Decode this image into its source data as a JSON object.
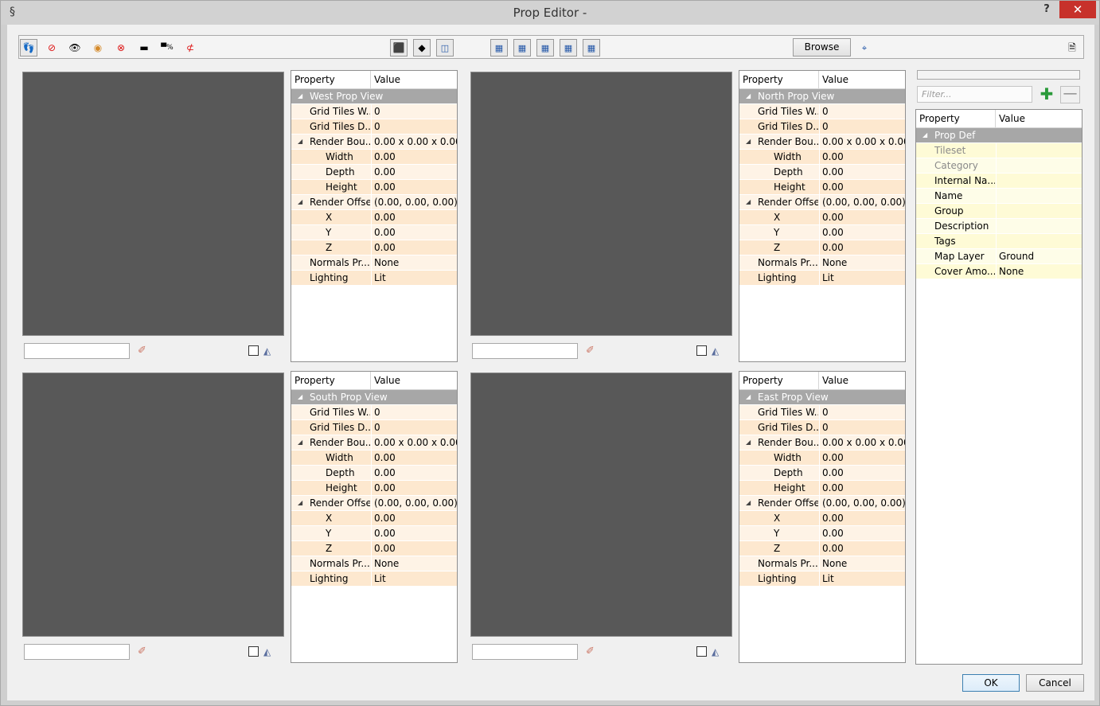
{
  "window": {
    "title": "Prop Editor -",
    "help_label": "?",
    "close_label": "✕"
  },
  "toolbar": {
    "browse_label": "Browse",
    "icons": [
      "footprint-icon",
      "footprint-disabled-icon",
      "eye-icon",
      "eye-orange-icon",
      "eye-disabled-icon",
      "line-icon",
      "percent-overlay-icon",
      "line-disabled-icon",
      "cube-top-icon",
      "plane-icon",
      "rotate-view-icon",
      "layout-1-icon",
      "layout-2-icon",
      "layout-3-icon",
      "layout-4-icon",
      "layout-5-icon",
      "target-icon",
      "save-icon"
    ]
  },
  "grid_headers": {
    "property": "Property",
    "value": "Value"
  },
  "views": [
    {
      "section": "West Prop View",
      "rows": [
        {
          "label": "Grid Tiles W...",
          "value": "0",
          "level": 1
        },
        {
          "label": "Grid Tiles D...",
          "value": "0",
          "level": 1
        },
        {
          "label": "Render Bou...",
          "value": "0.00 x 0.00 x 0.00",
          "level": 1,
          "expanded": true
        },
        {
          "label": "Width",
          "value": "0.00",
          "level": 2
        },
        {
          "label": "Depth",
          "value": "0.00",
          "level": 2
        },
        {
          "label": "Height",
          "value": "0.00",
          "level": 2
        },
        {
          "label": "Render Offset",
          "value": "(0.00, 0.00, 0.00)",
          "level": 1,
          "expanded": true
        },
        {
          "label": "X",
          "value": "0.00",
          "level": 2
        },
        {
          "label": "Y",
          "value": "0.00",
          "level": 2
        },
        {
          "label": "Z",
          "value": "0.00",
          "level": 2
        },
        {
          "label": "Normals Pr...",
          "value": "None",
          "level": 1
        },
        {
          "label": "Lighting",
          "value": "Lit",
          "level": 1
        }
      ]
    },
    {
      "section": "North Prop View",
      "rows": [
        {
          "label": "Grid Tiles W...",
          "value": "0",
          "level": 1
        },
        {
          "label": "Grid Tiles D...",
          "value": "0",
          "level": 1
        },
        {
          "label": "Render Bou...",
          "value": "0.00 x 0.00 x 0.00",
          "level": 1,
          "expanded": true
        },
        {
          "label": "Width",
          "value": "0.00",
          "level": 2
        },
        {
          "label": "Depth",
          "value": "0.00",
          "level": 2
        },
        {
          "label": "Height",
          "value": "0.00",
          "level": 2
        },
        {
          "label": "Render Offset",
          "value": "(0.00, 0.00, 0.00)",
          "level": 1,
          "expanded": true
        },
        {
          "label": "X",
          "value": "0.00",
          "level": 2
        },
        {
          "label": "Y",
          "value": "0.00",
          "level": 2
        },
        {
          "label": "Z",
          "value": "0.00",
          "level": 2
        },
        {
          "label": "Normals Pr...",
          "value": "None",
          "level": 1
        },
        {
          "label": "Lighting",
          "value": "Lit",
          "level": 1
        }
      ]
    },
    {
      "section": "South Prop View",
      "rows": [
        {
          "label": "Grid Tiles W...",
          "value": "0",
          "level": 1
        },
        {
          "label": "Grid Tiles D...",
          "value": "0",
          "level": 1
        },
        {
          "label": "Render Bou...",
          "value": "0.00 x 0.00 x 0.00",
          "level": 1,
          "expanded": true
        },
        {
          "label": "Width",
          "value": "0.00",
          "level": 2
        },
        {
          "label": "Depth",
          "value": "0.00",
          "level": 2
        },
        {
          "label": "Height",
          "value": "0.00",
          "level": 2
        },
        {
          "label": "Render Offset",
          "value": "(0.00, 0.00, 0.00)",
          "level": 1,
          "expanded": true
        },
        {
          "label": "X",
          "value": "0.00",
          "level": 2
        },
        {
          "label": "Y",
          "value": "0.00",
          "level": 2
        },
        {
          "label": "Z",
          "value": "0.00",
          "level": 2
        },
        {
          "label": "Normals Pr...",
          "value": "None",
          "level": 1
        },
        {
          "label": "Lighting",
          "value": "Lit",
          "level": 1
        }
      ]
    },
    {
      "section": "East Prop View",
      "rows": [
        {
          "label": "Grid Tiles W...",
          "value": "0",
          "level": 1
        },
        {
          "label": "Grid Tiles D...",
          "value": "0",
          "level": 1
        },
        {
          "label": "Render Bou...",
          "value": "0.00 x 0.00 x 0.00",
          "level": 1,
          "expanded": true
        },
        {
          "label": "Width",
          "value": "0.00",
          "level": 2
        },
        {
          "label": "Depth",
          "value": "0.00",
          "level": 2
        },
        {
          "label": "Height",
          "value": "0.00",
          "level": 2
        },
        {
          "label": "Render Offset",
          "value": "(0.00, 0.00, 0.00)",
          "level": 1,
          "expanded": true
        },
        {
          "label": "X",
          "value": "0.00",
          "level": 2
        },
        {
          "label": "Y",
          "value": "0.00",
          "level": 2
        },
        {
          "label": "Z",
          "value": "0.00",
          "level": 2
        },
        {
          "label": "Normals Pr...",
          "value": "None",
          "level": 1
        },
        {
          "label": "Lighting",
          "value": "Lit",
          "level": 1
        }
      ]
    }
  ],
  "prop_def": {
    "filter_placeholder": "Filter...",
    "add_label": "✚",
    "remove_label": "—",
    "section": "Prop Def",
    "rows": [
      {
        "label": "Tileset",
        "value": "",
        "disabled": true
      },
      {
        "label": "Category",
        "value": "",
        "disabled": true
      },
      {
        "label": "Internal Na...",
        "value": ""
      },
      {
        "label": "Name",
        "value": ""
      },
      {
        "label": "Group",
        "value": ""
      },
      {
        "label": "Description",
        "value": ""
      },
      {
        "label": "Tags",
        "value": ""
      },
      {
        "label": "Map Layer",
        "value": "Ground"
      },
      {
        "label": "Cover Amo...",
        "value": "None"
      }
    ]
  },
  "buttons": {
    "ok_label": "OK",
    "cancel_label": "Cancel"
  }
}
